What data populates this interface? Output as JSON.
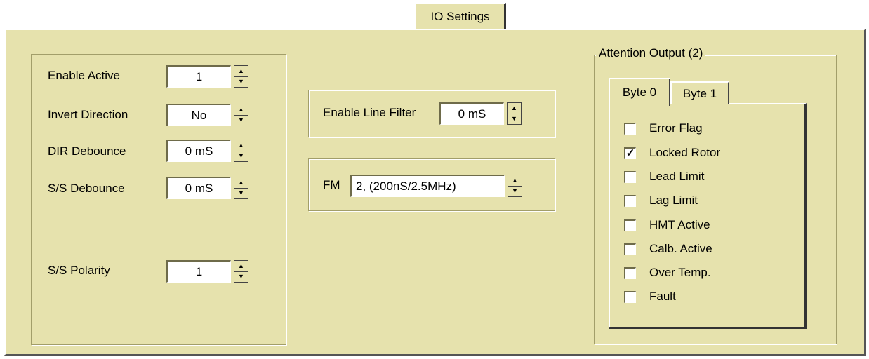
{
  "tab": {
    "label": "IO Settings"
  },
  "left_group": {
    "rows": [
      {
        "label": "Enable Active",
        "value": "1"
      },
      {
        "label": "Invert Direction",
        "value": "No"
      },
      {
        "label": "DIR Debounce",
        "value": "0 mS"
      },
      {
        "label": "S/S Debounce",
        "value": "0 mS"
      },
      {
        "label": "S/S Polarity",
        "value": "1"
      }
    ]
  },
  "line_filter": {
    "label": "Enable Line Filter",
    "value": "0 mS"
  },
  "fm": {
    "label": "FM",
    "value": "2, (200nS/2.5MHz)"
  },
  "attention": {
    "title": "Attention Output  (2)",
    "tabs": [
      {
        "label": "Byte 0"
      },
      {
        "label": "Byte 1"
      }
    ],
    "flags": [
      {
        "label": "Error Flag",
        "checked": false,
        "mark": ""
      },
      {
        "label": "Locked Rotor",
        "checked": true,
        "mark": "✓"
      },
      {
        "label": "Lead Limit",
        "checked": false,
        "mark": ""
      },
      {
        "label": "Lag Limit",
        "checked": false,
        "mark": ""
      },
      {
        "label": "HMT Active",
        "checked": false,
        "mark": ""
      },
      {
        "label": "Calb. Active",
        "checked": false,
        "mark": ""
      },
      {
        "label": "Over Temp.",
        "checked": false,
        "mark": ""
      },
      {
        "label": "Fault",
        "checked": false,
        "mark": ""
      }
    ]
  },
  "icons": {
    "spin_up": "▲",
    "spin_down": "▼"
  }
}
